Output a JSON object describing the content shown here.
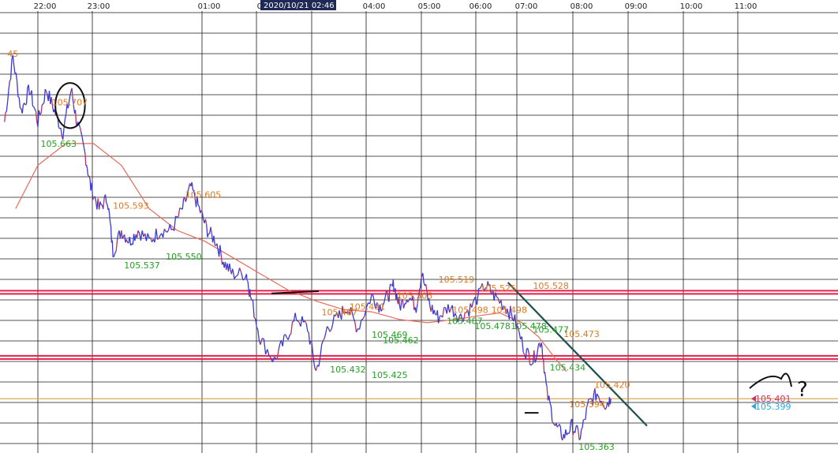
{
  "cursor_time": "2020/10/21 02:46",
  "colors": {
    "grid": "#1a1a1a",
    "price": "#3a3ad0",
    "price_alt": "#c03060",
    "moving_average": "#e86a5a",
    "resistance": "#e0204a",
    "support_orange": "#d9a040",
    "trendline": "#1f4f4f",
    "high_label": "#e07820",
    "low_label": "#22a022",
    "cyan_label": "#2aa8d8",
    "pink_label": "#d0306a"
  },
  "annotation_glyph": "?",
  "chart_data": {
    "type": "line",
    "title": "",
    "x_tick_labels": [
      "22:00",
      "23:00",
      "01:00",
      "02:00",
      "04:00",
      "05:00",
      "06:00",
      "07:00",
      "08:00",
      "09:00",
      "10:00",
      "11:00"
    ],
    "ylim": [
      105.355,
      105.762
    ],
    "grid": true,
    "price_series": {
      "name": "",
      "points": [
        [
          21.4,
          105.66
        ],
        [
          21.55,
          105.72
        ],
        [
          21.7,
          105.67
        ],
        [
          21.85,
          105.69
        ],
        [
          22.0,
          105.66
        ],
        [
          22.15,
          105.69
        ],
        [
          22.3,
          105.67
        ],
        [
          22.45,
          105.65
        ],
        [
          22.6,
          105.69
        ],
        [
          22.7,
          105.66
        ],
        [
          22.85,
          105.63
        ],
        [
          22.95,
          105.6
        ],
        [
          23.1,
          105.58
        ],
        [
          23.25,
          105.59
        ],
        [
          23.35,
          105.54
        ],
        [
          23.5,
          105.56
        ],
        [
          23.65,
          105.55
        ],
        [
          23.8,
          105.56
        ],
        [
          24.0,
          105.55
        ],
        [
          24.2,
          105.56
        ],
        [
          24.4,
          105.56
        ],
        [
          24.6,
          105.58
        ],
        [
          24.75,
          105.6
        ],
        [
          24.9,
          105.58
        ],
        [
          25.05,
          105.56
        ],
        [
          25.2,
          105.55
        ],
        [
          25.35,
          105.53
        ],
        [
          25.5,
          105.52
        ],
        [
          25.75,
          105.52
        ],
        [
          25.82,
          105.5
        ],
        [
          26.0,
          105.46
        ],
        [
          26.25,
          105.44
        ],
        [
          26.45,
          105.46
        ],
        [
          26.65,
          105.48
        ],
        [
          26.85,
          105.47
        ],
        [
          27.0,
          105.43
        ],
        [
          27.2,
          105.47
        ],
        [
          27.4,
          105.48
        ],
        [
          27.55,
          105.49
        ],
        [
          27.75,
          105.47
        ],
        [
          28.0,
          105.5
        ],
        [
          28.15,
          105.49
        ],
        [
          28.3,
          105.5
        ],
        [
          28.4,
          105.51
        ],
        [
          28.5,
          105.49
        ],
        [
          28.65,
          105.5
        ],
        [
          28.8,
          105.49
        ],
        [
          28.9,
          105.52
        ],
        [
          29.05,
          105.49
        ],
        [
          29.2,
          105.48
        ],
        [
          29.4,
          105.49
        ],
        [
          29.6,
          105.48
        ],
        [
          29.8,
          105.49
        ],
        [
          30.05,
          105.51
        ],
        [
          30.2,
          105.5
        ],
        [
          30.4,
          105.49
        ],
        [
          30.55,
          105.48
        ],
        [
          30.75,
          105.45
        ],
        [
          30.9,
          105.44
        ],
        [
          31.05,
          105.46
        ],
        [
          31.15,
          105.41
        ],
        [
          31.3,
          105.38
        ],
        [
          31.45,
          105.37
        ],
        [
          31.6,
          105.38
        ],
        [
          31.75,
          105.37
        ],
        [
          31.9,
          105.4
        ],
        [
          32.05,
          105.41
        ],
        [
          32.2,
          105.4
        ],
        [
          32.3,
          105.405
        ]
      ]
    },
    "moving_average": {
      "name": "",
      "points": [
        [
          21.6,
          105.58
        ],
        [
          22.0,
          105.62
        ],
        [
          22.5,
          105.64
        ],
        [
          23.0,
          105.64
        ],
        [
          23.5,
          105.62
        ],
        [
          24.0,
          105.58
        ],
        [
          24.5,
          105.56
        ],
        [
          25.0,
          105.55
        ],
        [
          25.5,
          105.535
        ],
        [
          26.0,
          105.52
        ],
        [
          26.5,
          105.505
        ],
        [
          27.0,
          105.495
        ],
        [
          27.5,
          105.487
        ],
        [
          28.0,
          105.485
        ],
        [
          28.5,
          105.478
        ],
        [
          29.0,
          105.475
        ],
        [
          29.5,
          105.478
        ],
        [
          30.0,
          105.482
        ],
        [
          30.3,
          105.484
        ],
        [
          30.7,
          105.475
        ],
        [
          31.0,
          105.462
        ],
        [
          31.3,
          105.442
        ],
        [
          31.5,
          105.43
        ]
      ]
    },
    "horizontal_lines": [
      {
        "y": 105.503,
        "role": "resistance"
      },
      {
        "y": 105.443,
        "role": "resistance"
      },
      {
        "y": 105.405,
        "role": "support_orange"
      }
    ],
    "drawn_lines": [
      {
        "from": [
          26.2,
          105.502
        ],
        "to": [
          27.05,
          105.504
        ],
        "role": "marker"
      },
      {
        "from": [
          30.45,
          105.512
        ],
        "to": [
          32.95,
          105.38
        ],
        "role": "trendline"
      },
      {
        "from": [
          30.75,
          105.392
        ],
        "to": [
          31.0,
          105.392
        ],
        "role": "marker"
      }
    ],
    "circle_marker": {
      "center": [
        22.58,
        105.675
      ],
      "radius_hours": 0.28
    },
    "high_labels": [
      {
        "text": "45",
        "x": 21.45,
        "y": 105.72
      },
      {
        "text": "105.707",
        "x": 22.25,
        "y": 105.675
      },
      {
        "text": "105.593",
        "x": 23.35,
        "y": 105.58
      },
      {
        "text": "105.605",
        "x": 24.65,
        "y": 105.59
      },
      {
        "text": "105.487",
        "x": 27.1,
        "y": 105.482
      },
      {
        "text": "105.491",
        "x": 27.6,
        "y": 105.487
      },
      {
        "text": "105.505",
        "x": 28.45,
        "y": 105.497
      },
      {
        "text": "105.519",
        "x": 29.2,
        "y": 105.512
      },
      {
        "text": "105.525",
        "x": 29.95,
        "y": 105.504
      },
      {
        "text": "105.498",
        "x": 29.45,
        "y": 105.484
      },
      {
        "text": "105.498",
        "x": 30.15,
        "y": 105.484
      },
      {
        "text": "105.528",
        "x": 30.9,
        "y": 105.506
      },
      {
        "text": "105.473",
        "x": 31.45,
        "y": 105.462
      },
      {
        "text": "105.420",
        "x": 32.0,
        "y": 105.415
      },
      {
        "text": "105.394",
        "x": 31.55,
        "y": 105.397
      }
    ],
    "low_labels": [
      {
        "text": "105.663",
        "x": 22.05,
        "y": 105.637
      },
      {
        "text": "105.537",
        "x": 23.55,
        "y": 105.525
      },
      {
        "text": "105.550",
        "x": 24.3,
        "y": 105.533
      },
      {
        "text": "105.469",
        "x": 28.0,
        "y": 105.461
      },
      {
        "text": "105.462",
        "x": 28.2,
        "y": 105.456
      },
      {
        "text": "105.432",
        "x": 27.25,
        "y": 105.429
      },
      {
        "text": "105.425",
        "x": 28.0,
        "y": 105.424
      },
      {
        "text": "105.487",
        "x": 29.35,
        "y": 105.474
      },
      {
        "text": "105.478",
        "x": 29.85,
        "y": 105.469
      },
      {
        "text": "105.478",
        "x": 30.5,
        "y": 105.469
      },
      {
        "text": "105.477",
        "x": 30.9,
        "y": 105.466
      },
      {
        "text": "105.434",
        "x": 31.2,
        "y": 105.431
      },
      {
        "text": "105.363",
        "x": 31.72,
        "y": 105.358
      }
    ],
    "price_markers": [
      {
        "text": "105.401",
        "role": "pink_label",
        "y": 105.405
      },
      {
        "text": "105.399",
        "role": "cyan_label",
        "y": 105.398
      }
    ]
  }
}
